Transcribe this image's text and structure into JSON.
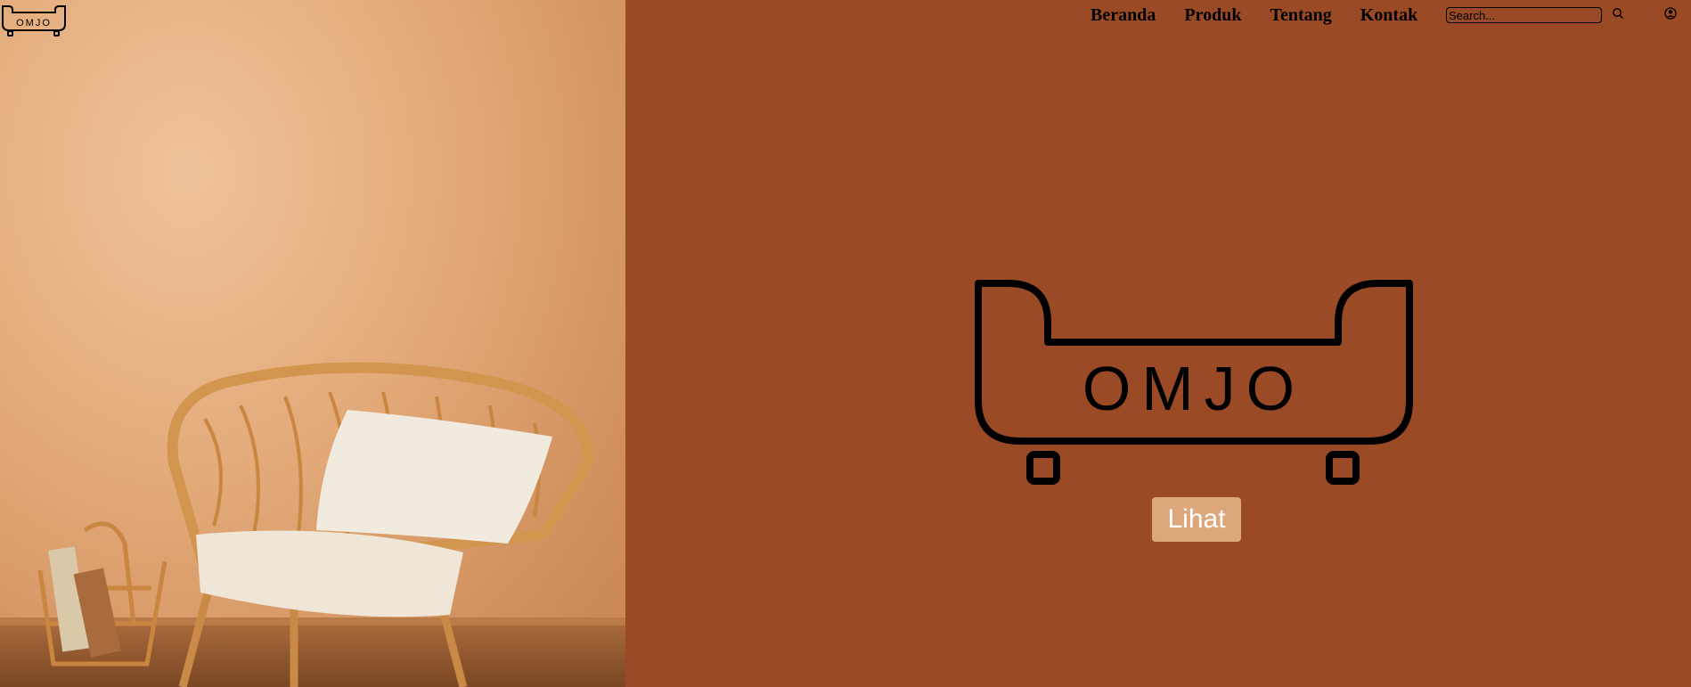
{
  "brand": {
    "name": "OMJO"
  },
  "nav": {
    "items": [
      {
        "label": "Beranda"
      },
      {
        "label": "Produk"
      },
      {
        "label": "Tentang"
      },
      {
        "label": "Kontak"
      }
    ]
  },
  "search": {
    "placeholder": "Search..."
  },
  "icons": {
    "search": "search-icon",
    "user": "user-icon"
  },
  "hero": {
    "button_label": "Lihat"
  },
  "colors": {
    "hero_background": "#9a4a25",
    "button_background": "#dca77a",
    "button_text": "#ffffff",
    "nav_text": "#000000"
  }
}
